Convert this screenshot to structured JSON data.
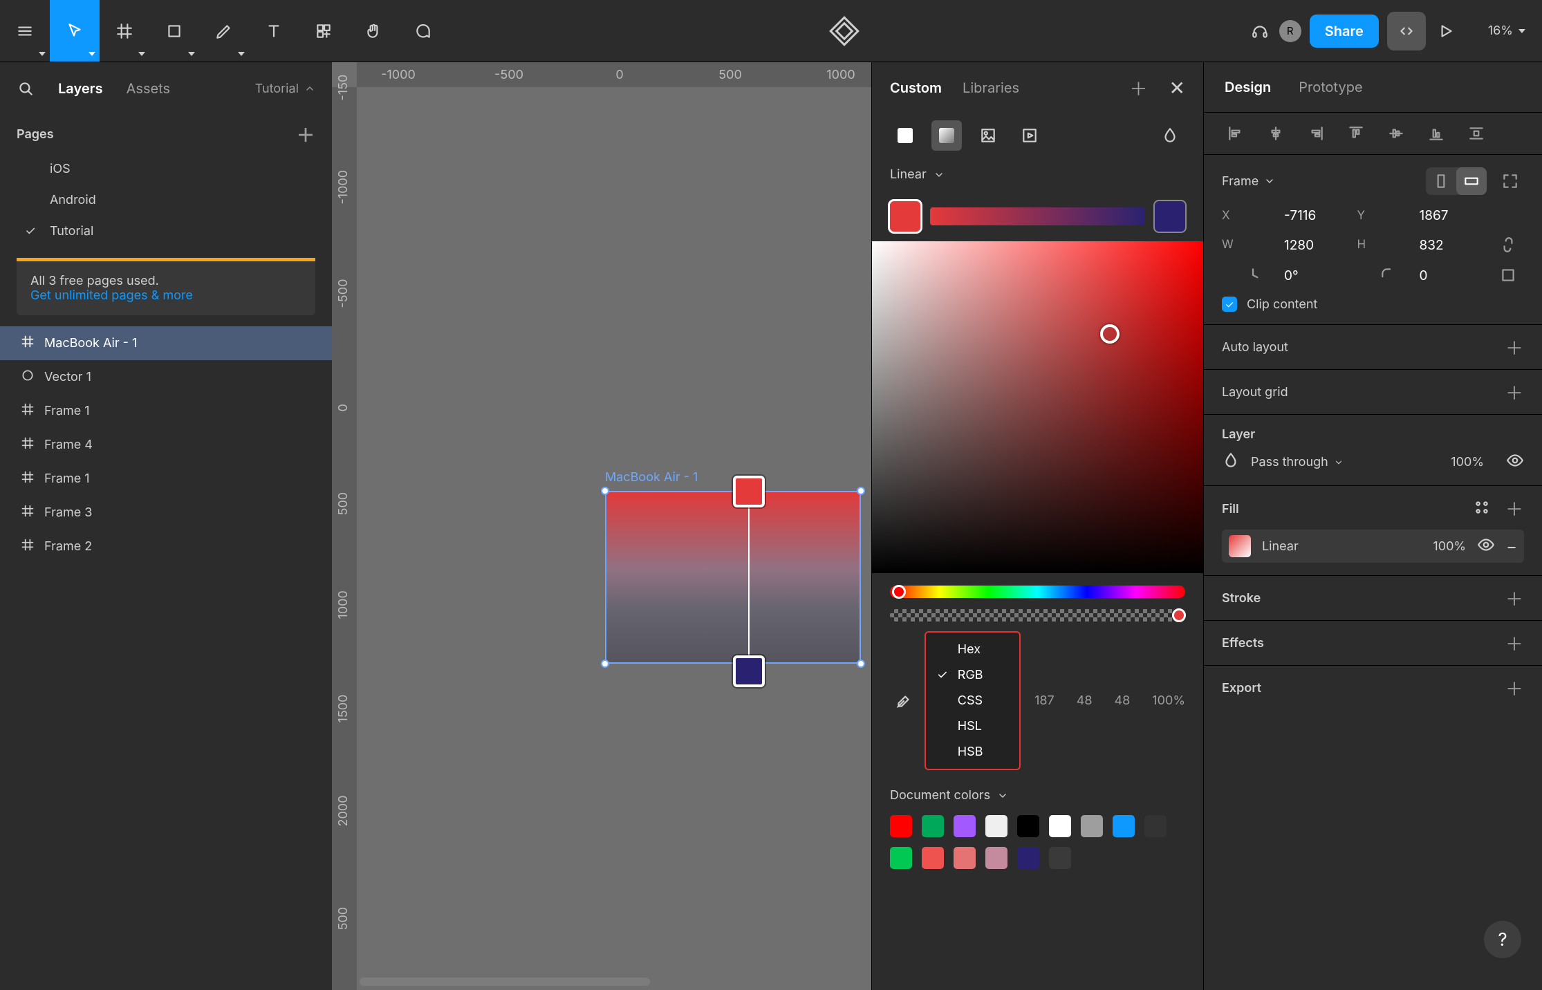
{
  "toolbar": {
    "share": "Share",
    "zoom": "16%",
    "avatar": "R"
  },
  "left": {
    "tabs": {
      "layers": "Layers",
      "assets": "Assets"
    },
    "project": "Tutorial",
    "pagesTitle": "Pages",
    "pages": [
      "iOS",
      "Android",
      "Tutorial"
    ],
    "pageSelected": 2,
    "notice": {
      "line": "All 3 free pages used.",
      "link": "Get unlimited pages & more"
    },
    "layers": [
      {
        "name": "MacBook Air - 1",
        "type": "frame",
        "sel": true
      },
      {
        "name": "Vector 1",
        "type": "vector"
      },
      {
        "name": "Frame 1",
        "type": "frame"
      },
      {
        "name": "Frame 4",
        "type": "frame"
      },
      {
        "name": "Frame 1",
        "type": "frame"
      },
      {
        "name": "Frame 3",
        "type": "frame"
      },
      {
        "name": "Frame 2",
        "type": "frame"
      }
    ]
  },
  "canvas": {
    "hticks": [
      "-1000",
      "-500",
      "0",
      "500",
      "1000"
    ],
    "vticks": [
      "-150",
      "-1000",
      "-500",
      "0",
      "500",
      "1000",
      "1500",
      "2000",
      "500"
    ],
    "frameLabel": "MacBook Air - 1"
  },
  "picker": {
    "tabs": {
      "custom": "Custom",
      "libraries": "Libraries"
    },
    "paintType": "Linear",
    "stopColors": [
      "#e43a3a",
      "#2a2270"
    ],
    "rgb": [
      "187",
      "48",
      "48",
      "100%"
    ],
    "formats": [
      "Hex",
      "RGB",
      "CSS",
      "HSL",
      "HSB"
    ],
    "formatSelected": "RGB",
    "docColorsTitle": "Document colors",
    "swatches": [
      "#ff0000",
      "#00a85a",
      "#a259ff",
      "#efefef",
      "#000000",
      "#ffffff",
      "#9e9e9e",
      "#0d99ff",
      "#333333",
      "#00c853",
      "#ef5350",
      "#e57373",
      "#c48b9f",
      "#2a2270",
      "#3a3a3a"
    ]
  },
  "design": {
    "tabs": {
      "design": "Design",
      "prototype": "Prototype"
    },
    "frameLabel": "Frame",
    "x": "-7116",
    "y": "1867",
    "w": "1280",
    "h": "832",
    "rot": "0°",
    "rad": "0",
    "clip": "Clip content",
    "autolayout": "Auto layout",
    "layoutgrid": "Layout grid",
    "layerTitle": "Layer",
    "blend": "Pass through",
    "layerOpacity": "100%",
    "fillTitle": "Fill",
    "fillType": "Linear",
    "fillOpacity": "100%",
    "strokeTitle": "Stroke",
    "effectsTitle": "Effects",
    "exportTitle": "Export"
  }
}
